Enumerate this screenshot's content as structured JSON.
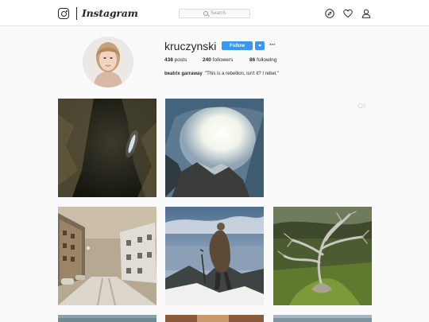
{
  "header": {
    "wordmark": "Instagram",
    "search_placeholder": "Search"
  },
  "profile": {
    "username": "kruczynski",
    "follow_label": "Follow",
    "more_label": "···",
    "posts_count": "438",
    "posts_label": "posts",
    "followers_count": "240",
    "followers_label": "followers",
    "following_count": "86",
    "following_label": "following",
    "full_name": "beatrix garraway",
    "bio": "\"This is a rebellion, isn't it? I rebel.\""
  },
  "colors": {
    "accent": "#3897f0",
    "background": "#fafafa",
    "text": "#262626"
  },
  "icons": [
    "instagram-logo-icon",
    "search-icon",
    "compass-icon",
    "heart-icon",
    "profile-icon",
    "chevron-down-icon",
    "close-icon"
  ],
  "posts": [
    {
      "id": "post-1",
      "subject": "cave interior with light"
    },
    {
      "id": "post-2",
      "subject": "icy cave opening"
    },
    {
      "id": "post-4",
      "subject": "snowy street with buildings"
    },
    {
      "id": "post-5",
      "subject": "person in fur coat on cliff"
    },
    {
      "id": "post-6",
      "subject": "gnarled tree on mossy field"
    }
  ]
}
